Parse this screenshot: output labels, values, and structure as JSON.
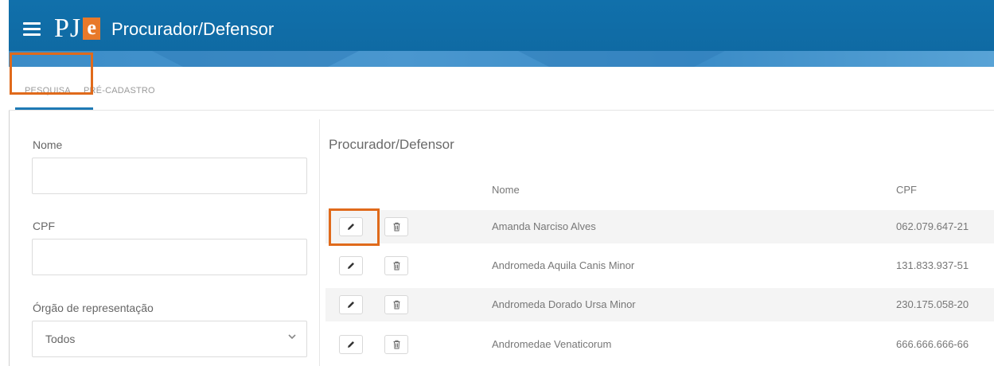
{
  "header": {
    "logo_pj": "PJ",
    "logo_e": "e",
    "title": "Procurador/Defensor"
  },
  "tabs": [
    {
      "label": "PESQUISA",
      "active": true
    },
    {
      "label": "PRÉ-CADASTRO",
      "active": false
    }
  ],
  "filters": {
    "nome_label": "Nome",
    "nome_value": "",
    "cpf_label": "CPF",
    "cpf_value": "",
    "orgao_label": "Órgão de representação",
    "orgao_selected": "Todos"
  },
  "results": {
    "title": "Procurador/Defensor",
    "columns": [
      "Nome",
      "CPF"
    ],
    "rows": [
      {
        "name": "Amanda Narciso Alves",
        "cpf": "062.079.647-21"
      },
      {
        "name": "Andromeda Aquila Canis Minor",
        "cpf": "131.833.937-51"
      },
      {
        "name": "Andromeda Dorado Ursa Minor",
        "cpf": "230.175.058-20"
      },
      {
        "name": "Andromedae Venaticorum",
        "cpf": "666.666.666-66"
      }
    ]
  },
  "icons": {
    "menu": "hamburger-menu-icon",
    "edit": "pencil-icon",
    "delete": "trash-icon",
    "select": "chevron-down-icon"
  },
  "colors": {
    "header": "#1170ab",
    "accent": "#1f7ab5",
    "logo_e": "#e8792a",
    "highlight": "#e06a1b"
  }
}
